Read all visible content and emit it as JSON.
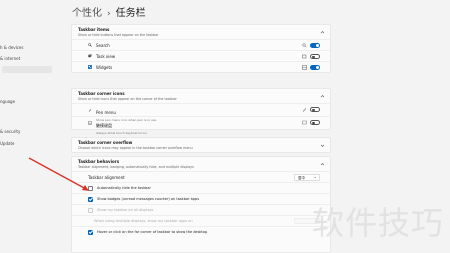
{
  "sidebar": {
    "items": [
      {
        "label": "h & devices"
      },
      {
        "label": "& internet"
      },
      {
        "label": ""
      },
      {
        "label": ""
      },
      {
        "label": "nguage"
      },
      {
        "label": "& security"
      },
      {
        "label": "Update"
      }
    ]
  },
  "breadcrumb": {
    "parent": "个性化",
    "current": "任务栏"
  },
  "taskbar_items": {
    "title": "Taskbar items",
    "subtitle": "Show or hide buttons that appear on the taskbar",
    "items": [
      {
        "label": "Search",
        "icon": "search-icon",
        "state": "on"
      },
      {
        "label": "Task view",
        "icon": "task-view-icon",
        "state": "off"
      },
      {
        "label": "Widgets",
        "icon": "widgets-icon",
        "state": "on"
      }
    ]
  },
  "corner_icons": {
    "title": "Taskbar corner icons",
    "subtitle": "Show or hide icons that appear on the corner of the taskbar",
    "items": [
      {
        "label": "Pen menu",
        "sub": "Show pen menu icon when pen is in use",
        "icon": "pen-icon",
        "state": "off"
      },
      {
        "label": "触摸键盘",
        "sub": "Always show touch keyboard icon",
        "icon": "keyboard-icon",
        "state": "off"
      }
    ]
  },
  "overflow": {
    "title": "Taskbar corner overflow",
    "subtitle": "Choose which icons may appear in the taskbar corner overflow menu"
  },
  "behaviors": {
    "title": "Taskbar behaviors",
    "subtitle": "Taskbar alignment, badging, automatically hide, and multiple displays",
    "alignment_label": "Taskbar alignment",
    "alignment_value": "居中",
    "options": [
      {
        "label": "Automatically hide the taskbar",
        "checked": false,
        "disabled": false
      },
      {
        "label": "Show badges (unread messages counter) on taskbar apps",
        "checked": true,
        "disabled": false
      },
      {
        "label": "Show my taskbar on all displays",
        "checked": false,
        "disabled": true
      },
      {
        "label": "When using multiple displays, show my taskbar apps on",
        "checked": false,
        "disabled": true
      },
      {
        "label": "Hover or click on the far corner of taskbar to show the desktop",
        "checked": true,
        "disabled": false
      }
    ]
  },
  "watermark": "软件技巧",
  "colors": {
    "accent": "#0067c0",
    "arrow": "#d9342b"
  }
}
